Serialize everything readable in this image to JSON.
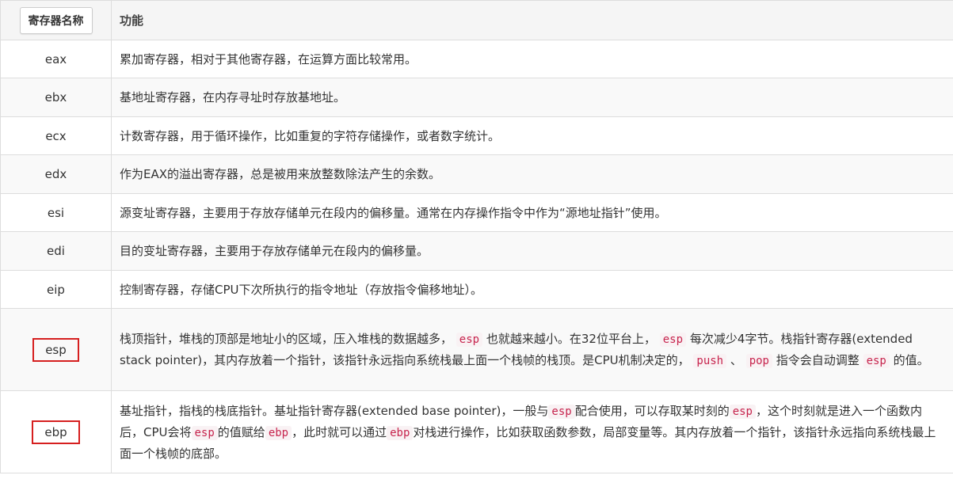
{
  "header": {
    "col1": "寄存器名称",
    "col2": "功能"
  },
  "rows": [
    {
      "name": "eax",
      "desc": "累加寄存器，相对于其他寄存器，在运算方面比较常用。"
    },
    {
      "name": "ebx",
      "desc": "基地址寄存器，在内存寻址时存放基地址。"
    },
    {
      "name": "ecx",
      "desc": "计数寄存器，用于循环操作，比如重复的字符存储操作，或者数字统计。"
    },
    {
      "name": "edx",
      "desc": "作为EAX的溢出寄存器，总是被用来放整数除法产生的余数。"
    },
    {
      "name": "esi",
      "desc": "源变址寄存器，主要用于存放存储单元在段内的偏移量。通常在内存操作指令中作为“源地址指针”使用。"
    },
    {
      "name": "edi",
      "desc": "目的变址寄存器，主要用于存放存储单元在段内的偏移量。"
    },
    {
      "name": "eip",
      "desc": "控制寄存器，存储CPU下次所执行的指令地址（存放指令偏移地址）。"
    }
  ],
  "esp_row": {
    "name": "esp",
    "t1": "栈顶指针，堆栈的顶部是地址小的区域，压入堆栈的数据越多，",
    "c1": "esp",
    "t2": "也就越来越小。在32位平台上，",
    "c2": "esp",
    "t3": "每次减少4字节。栈指针寄存器(extended stack pointer)，其内存放着一个指针，该指针永远指向系统栈最上面一个栈帧的栈顶。是CPU机制决定的，",
    "c3": "push",
    "sep": "、",
    "c4": "pop",
    "t4": "指令会自动调整",
    "c5": "esp",
    "t5": "的值。"
  },
  "ebp_row": {
    "name": "ebp",
    "t1": "基址指针，指栈的栈底指针。基址指针寄存器(extended base pointer)，一般与",
    "c1": "esp",
    "t2": "配合使用，可以存取某时刻的",
    "c2": "esp",
    "t3": "，这个时刻就是进入一个函数内后，CPU会将",
    "c3": "esp",
    "t4": "的值赋给",
    "c4": "ebp",
    "t5": "，此时就可以通过",
    "c5": "ebp",
    "t6": "对栈进行操作，比如获取函数参数，局部变量等。其内存放着一个指针，该指针永远指向系统栈最上面一个栈帧的底部。"
  },
  "colors": {
    "highlight_box": "#d61f1f",
    "code_text": "#c7254e",
    "code_bg": "#f9f2f4"
  }
}
